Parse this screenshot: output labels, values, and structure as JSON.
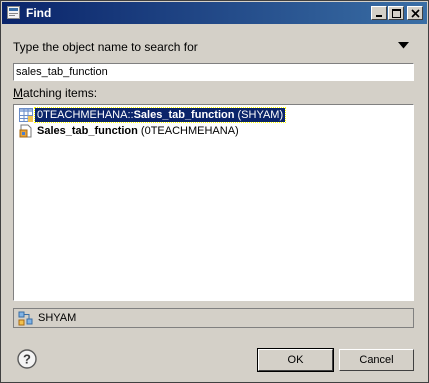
{
  "window": {
    "title": "Find"
  },
  "prompt": {
    "label": "Type the object name to search for"
  },
  "search": {
    "value": "sales_tab_function"
  },
  "matching": {
    "label": "Matching items:"
  },
  "results": [
    {
      "prefix": "0TEACHMEHANA::",
      "name": "Sales_tab_function",
      "suffix": " (SHYAM)",
      "icon": "table-function-icon",
      "selected": true
    },
    {
      "prefix": "",
      "name": "Sales_tab_function",
      "suffix": " (0TEACHMEHANA)",
      "icon": "package-file-icon",
      "selected": false
    }
  ],
  "status": {
    "text": "SHYAM",
    "icon": "schema-icon"
  },
  "buttons": {
    "ok": "OK",
    "cancel": "Cancel"
  },
  "colors": {
    "titlebar": "#0a246a",
    "selection": "#0a246a",
    "face": "#d4d0c8"
  }
}
